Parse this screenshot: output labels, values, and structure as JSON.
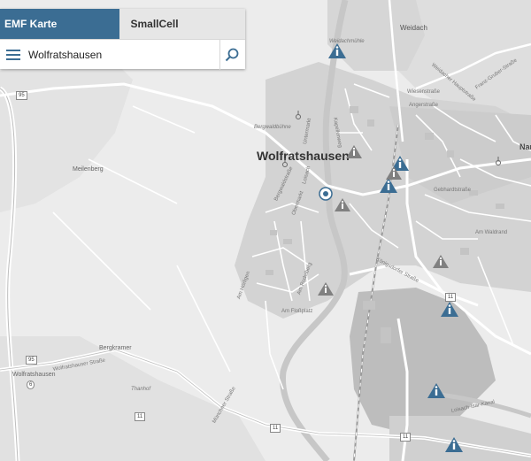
{
  "tabs": [
    {
      "label": "EMF Karte",
      "active": true
    },
    {
      "label": "SmallCell",
      "active": false
    }
  ],
  "search": {
    "value": "Wolfratshausen"
  },
  "icons": {
    "menu": "hamburger-menu-icon",
    "search": "search-icon",
    "info": "info-triangle-icon"
  },
  "colors": {
    "tab_active": "#3b6d93",
    "info_marker": "#3b6d93",
    "map_base": "#e9e9e9",
    "urban": "#cfcfcf"
  },
  "map": {
    "town_labels": {
      "wolfratshausen_main": "Wolfratshausen",
      "narr": "Nar",
      "weidach": "Weidach",
      "meilenberg": "Meilenberg",
      "bergkramer": "Bergkramer",
      "wolfratshausen_sw": "Wolfratshausen",
      "thanhof": "Thanhof",
      "bergwaldbühne": "Bergwaldbühne",
      "weidachmühle": "Weidachmühle"
    },
    "street_labels": {
      "wolfratshauser": "Wolfratshauser Straße",
      "loisach_isar_kanal": "Loisach-Isar-Kanal",
      "wiesenstrasse": "Wiesenstraße",
      "angerstrasse": "Angerstraße",
      "gebhardtstrasse": "Gebhardtstraße",
      "koenigsdorfer": "Königsdorfer Straße",
      "am_waldrand": "Am Waldrand",
      "am_floessplatz": "Am Floßplatz",
      "bergwaldstrasse": "Bergwaldstraße",
      "am_hoerligen": "Am Hörligen",
      "muenchner_strasse": "Münchner Straße",
      "obermarkt": "Obermarkt",
      "untermarkt": "Untermarkt",
      "am_rodelberg": "Am Rodelberg",
      "loisach": "Loisach",
      "kapellenweg": "Kapellenweg",
      "weidacher": "Weidacher Hauptstraße",
      "franz_gruber": "Franz-Gruber-Straße"
    },
    "road_numbers": {
      "b11_a": "11",
      "b11_b": "11",
      "b11_c": "11",
      "r95_a": "95",
      "r95_b": "95",
      "b11_d": "11",
      "a6": "6"
    }
  }
}
